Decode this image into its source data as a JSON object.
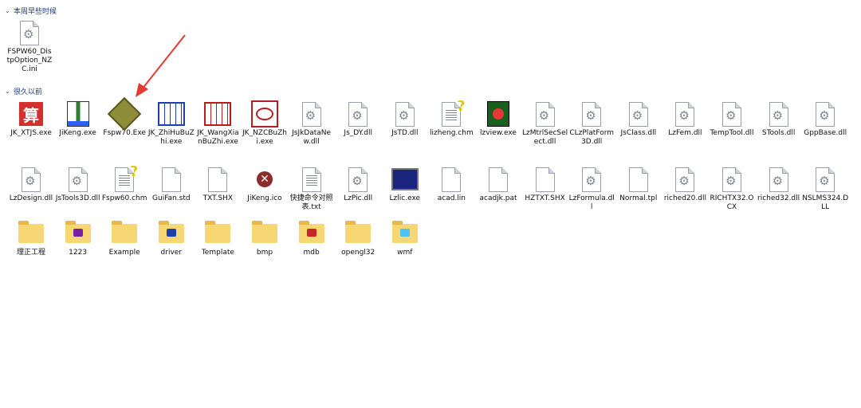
{
  "groups": {
    "recent": {
      "label": "本周早些时候"
    },
    "older": {
      "label": "很久以前"
    }
  },
  "recent_files": [
    {
      "label": "FSPW60_DistpOption_NZC.ini",
      "icon": "config-file-icon"
    }
  ],
  "row1": [
    {
      "label": "JK_XTJS.exe",
      "icon": "suan-app-icon"
    },
    {
      "label": "JiKeng.exe",
      "icon": "jikeng-app-icon"
    },
    {
      "label": "Fspw70.Exe",
      "icon": "fspw-app-icon"
    },
    {
      "label": "JK_ZhiHuBuZhi.exe",
      "icon": "blueprint-app-icon"
    },
    {
      "label": "JK_WangXianBuZhi.exe",
      "icon": "grid-app-icon"
    },
    {
      "label": "JK_NZCBuZhi.exe",
      "icon": "nzc-app-icon"
    },
    {
      "label": "JsJkDataNew.dll",
      "icon": "dll-file-icon"
    },
    {
      "label": "Js_DY.dll",
      "icon": "dll-file-icon"
    },
    {
      "label": "JsTD.dll",
      "icon": "dll-file-icon"
    },
    {
      "label": "lizheng.chm",
      "icon": "help-file-icon"
    },
    {
      "label": "lzview.exe",
      "icon": "lzview-app-icon"
    },
    {
      "label": "LzMtrlSecSelect.dll",
      "icon": "dll-file-icon"
    },
    {
      "label": "CLzPlatForm3D.dll",
      "icon": "dll-file-icon"
    },
    {
      "label": "JsClass.dll",
      "icon": "dll-file-icon"
    },
    {
      "label": "LzFem.dll",
      "icon": "dll-file-icon"
    },
    {
      "label": "TempTool.dll",
      "icon": "dll-file-icon"
    },
    {
      "label": "STools.dll",
      "icon": "dll-file-icon"
    },
    {
      "label": "GppBase.dll",
      "icon": "dll-file-icon"
    }
  ],
  "row2": [
    {
      "label": "LzDesign.dll",
      "icon": "dll-file-icon"
    },
    {
      "label": "JsTools3D.dll",
      "icon": "dll-file-icon"
    },
    {
      "label": "Fspw60.chm",
      "icon": "help-file-icon"
    },
    {
      "label": "GuiFan.std",
      "icon": "blank-file-icon"
    },
    {
      "label": "TXT.SHX",
      "icon": "blank-file-icon"
    },
    {
      "label": "JiKeng.ico",
      "icon": "jikeng-ico-icon"
    },
    {
      "label": "快捷命令对照表.txt",
      "icon": "text-file-icon"
    },
    {
      "label": "LzPic.dll",
      "icon": "dll-file-icon"
    },
    {
      "label": "Lzlic.exe",
      "icon": "computer-app-icon"
    },
    {
      "label": "acad.lin",
      "icon": "blank-file-icon"
    },
    {
      "label": "acadjk.pat",
      "icon": "blank-file-icon"
    },
    {
      "label": "HZTXT.SHX",
      "icon": "blank-file-icon"
    },
    {
      "label": "LzFormula.dll",
      "icon": "dll-file-icon"
    },
    {
      "label": "Normal.tpl",
      "icon": "blank-file-icon"
    },
    {
      "label": "riched20.dll",
      "icon": "dll-file-icon"
    },
    {
      "label": "RICHTX32.OCX",
      "icon": "dll-file-icon"
    },
    {
      "label": "riched32.dll",
      "icon": "dll-file-icon"
    },
    {
      "label": "NSLMS324.DLL",
      "icon": "dll-file-icon"
    }
  ],
  "folders": [
    {
      "label": "理正工程",
      "icon": "folder-icon"
    },
    {
      "label": "1223",
      "icon": "folder-icon"
    },
    {
      "label": "Example",
      "icon": "folder-icon"
    },
    {
      "label": "driver",
      "icon": "folder-icon"
    },
    {
      "label": "Template",
      "icon": "folder-icon"
    },
    {
      "label": "bmp",
      "icon": "folder-icon"
    },
    {
      "label": "mdb",
      "icon": "folder-icon"
    },
    {
      "label": "opengl32",
      "icon": "folder-icon"
    },
    {
      "label": "wmf",
      "icon": "folder-icon"
    }
  ],
  "colors": {
    "header": "#1e3a8a",
    "folder": "#f7d774",
    "arrow": "#e53935"
  }
}
